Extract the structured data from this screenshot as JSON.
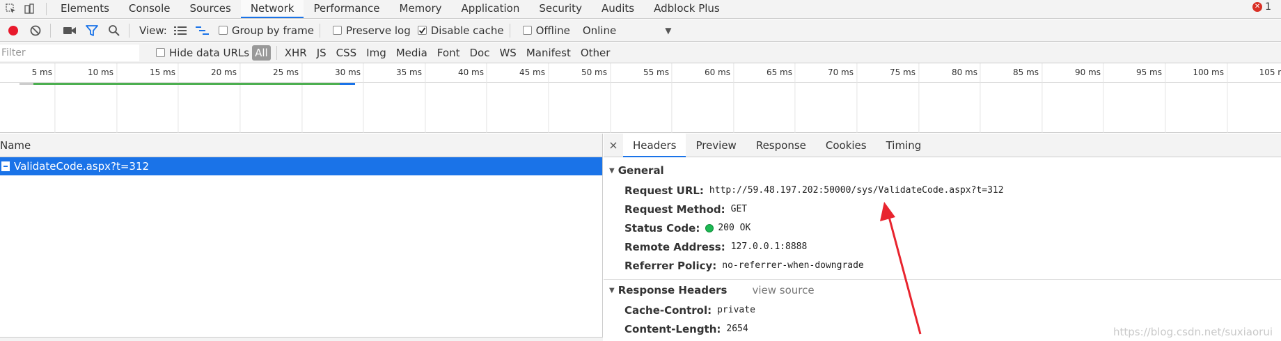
{
  "tabbar": {
    "tabs": [
      "Elements",
      "Console",
      "Sources",
      "Network",
      "Performance",
      "Memory",
      "Application",
      "Security",
      "Audits",
      "Adblock Plus"
    ],
    "error_count": "1"
  },
  "toolbar": {
    "view_label": "View:",
    "group_by_frame": "Group by frame",
    "preserve_log": "Preserve log",
    "disable_cache": "Disable cache",
    "offline": "Offline",
    "throttle": "Online"
  },
  "filterbar": {
    "placeholder": "Filter",
    "hide_data_urls": "Hide data URLs",
    "types": [
      "All",
      "XHR",
      "JS",
      "CSS",
      "Img",
      "Media",
      "Font",
      "Doc",
      "WS",
      "Manifest",
      "Other"
    ]
  },
  "timeline": {
    "ticks": [
      "5 ms",
      "10 ms",
      "15 ms",
      "20 ms",
      "25 ms",
      "30 ms",
      "35 ms",
      "40 ms",
      "45 ms",
      "50 ms",
      "55 ms",
      "60 ms",
      "65 ms",
      "70 ms",
      "75 ms",
      "80 ms",
      "85 ms",
      "90 ms",
      "95 ms",
      "100 ms",
      "105 m"
    ]
  },
  "list": {
    "header": "Name",
    "rows": [
      "ValidateCode.aspx?t=312"
    ]
  },
  "detail": {
    "close": "×",
    "tabs": [
      "Headers",
      "Preview",
      "Response",
      "Cookies",
      "Timing"
    ],
    "general": {
      "title": "General",
      "request_url_key": "Request URL:",
      "request_url_val": "http://59.48.197.202:50000/sys/ValidateCode.aspx?t=312",
      "request_method_key": "Request Method:",
      "request_method_val": "GET",
      "status_code_key": "Status Code:",
      "status_code_val": "200 OK",
      "remote_address_key": "Remote Address:",
      "remote_address_val": "127.0.0.1:8888",
      "referrer_policy_key": "Referrer Policy:",
      "referrer_policy_val": "no-referrer-when-downgrade"
    },
    "response_headers": {
      "title": "Response Headers",
      "view_source": "view source",
      "cache_control_key": "Cache-Control:",
      "cache_control_val": "private",
      "content_length_key": "Content-Length:",
      "content_length_val": "2654"
    }
  },
  "watermark": "https://blog.csdn.net/suxiaorui",
  "colors": {
    "accent": "#1a73e8",
    "record": "#e8192c",
    "status_ok": "#1db954",
    "arrow": "#e8242e"
  }
}
